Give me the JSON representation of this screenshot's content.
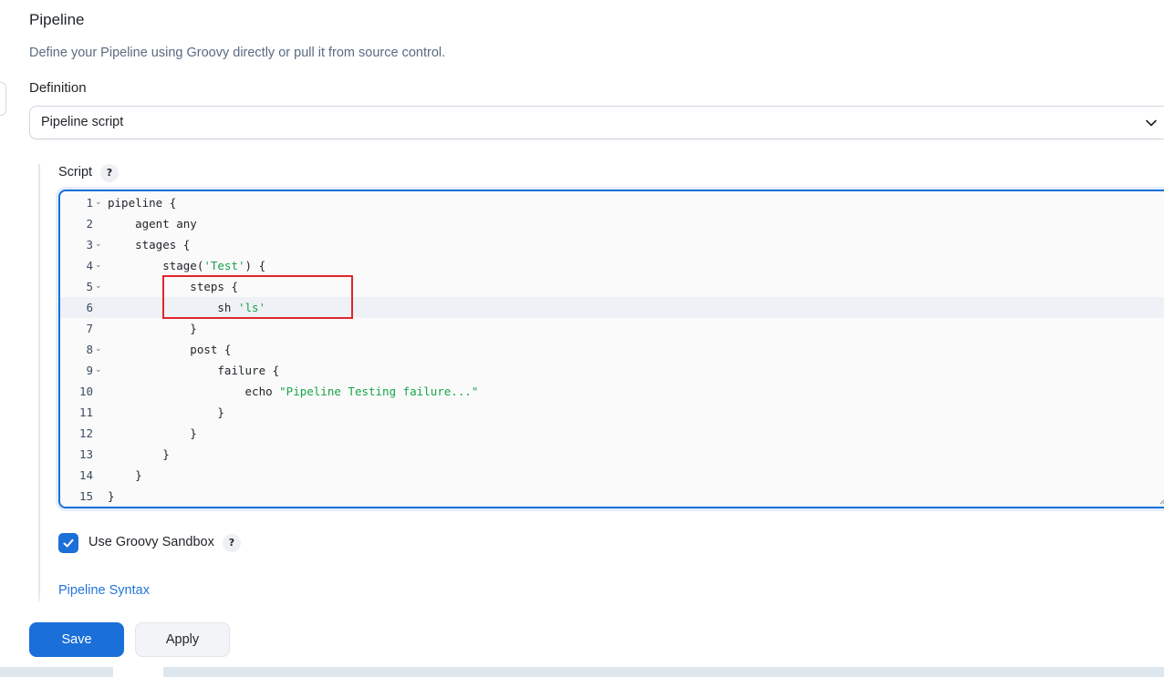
{
  "section": {
    "title": "Pipeline",
    "description": "Define your Pipeline using Groovy directly or pull it from source control."
  },
  "definition": {
    "label": "Definition",
    "selected": "Pipeline script"
  },
  "script": {
    "label": "Script",
    "help": "?",
    "lines": [
      {
        "num": "1",
        "fold": true,
        "text": "pipeline {"
      },
      {
        "num": "2",
        "fold": false,
        "text": "    agent any"
      },
      {
        "num": "3",
        "fold": true,
        "text": "    stages {"
      },
      {
        "num": "4",
        "fold": true,
        "pre": "        stage(",
        "str": "'Test'",
        "post": ") {"
      },
      {
        "num": "5",
        "fold": true,
        "text": "            steps {"
      },
      {
        "num": "6",
        "fold": false,
        "pre": "                sh ",
        "str": "'ls'",
        "post": "",
        "active": true
      },
      {
        "num": "7",
        "fold": false,
        "text": "            }"
      },
      {
        "num": "8",
        "fold": true,
        "text": "            post {"
      },
      {
        "num": "9",
        "fold": true,
        "text": "                failure {"
      },
      {
        "num": "10",
        "fold": false,
        "pre": "                    echo ",
        "str": "\"Pipeline Testing failure...\"",
        "post": ""
      },
      {
        "num": "11",
        "fold": false,
        "text": "                }"
      },
      {
        "num": "12",
        "fold": false,
        "text": "            }"
      },
      {
        "num": "13",
        "fold": false,
        "text": "        }"
      },
      {
        "num": "14",
        "fold": false,
        "text": "    }"
      },
      {
        "num": "15",
        "fold": false,
        "text": "}"
      }
    ]
  },
  "sandbox": {
    "label": "Use Groovy Sandbox",
    "checked": true,
    "help": "?"
  },
  "links": {
    "pipeline_syntax": "Pipeline Syntax"
  },
  "buttons": {
    "save": "Save",
    "apply": "Apply"
  },
  "colors": {
    "accent": "#1a6fd8",
    "string": "#1aa34a",
    "highlight": "#e0262b"
  }
}
